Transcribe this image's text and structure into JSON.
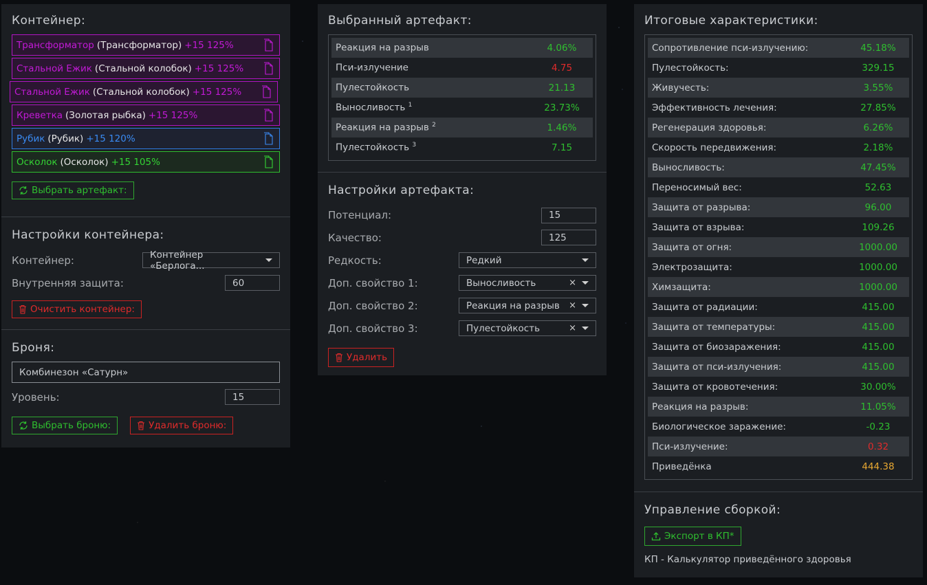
{
  "container_panel": {
    "title": "Контейнер:",
    "artifacts": [
      {
        "name": "Трансформатор",
        "copy": "(Трансформатор)",
        "bonus": "+15 125%",
        "color": "magenta"
      },
      {
        "name": "Стальной Ежик",
        "copy": "(Стальной колобок)",
        "bonus": "+15 125%",
        "color": "magenta"
      },
      {
        "name": "Стальной Ежик",
        "copy": "(Стальной колобок)",
        "bonus": "+15 125%",
        "color": "magenta"
      },
      {
        "name": "Креветка",
        "copy": "(Золотая рыбка)",
        "bonus": "+15 125%",
        "color": "magenta"
      },
      {
        "name": "Рубик",
        "copy": "(Рубик)",
        "bonus": "+15 120%",
        "color": "blue"
      },
      {
        "name": "Осколок",
        "copy": "(Осколок)",
        "bonus": "+15 105%",
        "color": "green"
      }
    ],
    "choose_artifact_btn": "Выбрать артефакт:"
  },
  "container_settings": {
    "title": "Настройки контейнера:",
    "container_label": "Контейнер:",
    "container_value": "Контейнер «Берлога...",
    "inner_protection_label": "Внутренняя защита:",
    "inner_protection_value": "60",
    "clear_btn": "Очистить контейнер:"
  },
  "armor": {
    "title": "Броня:",
    "name_value": "Комбинезон «Сатурн»",
    "level_label": "Уровень:",
    "level_value": "15",
    "choose_btn": "Выбрать броню:",
    "delete_btn": "Удалить броню:"
  },
  "selected_artifact": {
    "title": "Выбранный артефакт:",
    "stats": [
      {
        "label": "Реакция на разрыв",
        "sup": "",
        "value": "4.06%",
        "color": "g"
      },
      {
        "label": "Пси-излучение",
        "sup": "",
        "value": "4.75",
        "color": "r"
      },
      {
        "label": "Пулестойкость",
        "sup": "",
        "value": "21.13",
        "color": "g"
      },
      {
        "label": "Выносливость",
        "sup": "1",
        "value": "23.73%",
        "color": "g"
      },
      {
        "label": "Реакция на разрыв",
        "sup": "2",
        "value": "1.46%",
        "color": "g"
      },
      {
        "label": "Пулестойкость",
        "sup": "3",
        "value": "7.15",
        "color": "g"
      }
    ]
  },
  "artifact_settings": {
    "title": "Настройки артефакта:",
    "potential_label": "Потенциал:",
    "potential_value": "15",
    "quality_label": "Качество:",
    "quality_value": "125",
    "rarity_label": "Редкость:",
    "rarity_value": "Редкий",
    "prop1_label": "Доп. свойство 1:",
    "prop1_value": "Выносливость",
    "prop2_label": "Доп. свойство 2:",
    "prop2_value": "Реакция на разрыв",
    "prop3_label": "Доп. свойство 3:",
    "prop3_value": "Пулестойкость",
    "clear_x": "×",
    "delete_btn": "Удалить"
  },
  "totals": {
    "title": "Итоговые характеристики:",
    "stats": [
      {
        "label": "Сопротивление пси-излучению:",
        "value": "45.18%",
        "color": "g"
      },
      {
        "label": "Пулестойкость:",
        "value": "329.15",
        "color": "g"
      },
      {
        "label": "Живучесть:",
        "value": "3.55%",
        "color": "g"
      },
      {
        "label": "Эффективность лечения:",
        "value": "27.85%",
        "color": "g"
      },
      {
        "label": "Регенерация здоровья:",
        "value": "6.26%",
        "color": "g"
      },
      {
        "label": "Скорость передвижения:",
        "value": "2.18%",
        "color": "g"
      },
      {
        "label": "Выносливость:",
        "value": "47.45%",
        "color": "g"
      },
      {
        "label": "Переносимый вес:",
        "value": "52.63",
        "color": "g"
      },
      {
        "label": "Защита от разрыва:",
        "value": "96.00",
        "color": "g"
      },
      {
        "label": "Защита от взрыва:",
        "value": "109.26",
        "color": "g"
      },
      {
        "label": "Защита от огня:",
        "value": "1000.00",
        "color": "g"
      },
      {
        "label": "Электрозащита:",
        "value": "1000.00",
        "color": "g"
      },
      {
        "label": "Химзащита:",
        "value": "1000.00",
        "color": "g"
      },
      {
        "label": "Защита от радиации:",
        "value": "415.00",
        "color": "g"
      },
      {
        "label": "Защита от температуры:",
        "value": "415.00",
        "color": "g"
      },
      {
        "label": "Защита от биозаражения:",
        "value": "415.00",
        "color": "g"
      },
      {
        "label": "Защита от пси-излучения:",
        "value": "415.00",
        "color": "g"
      },
      {
        "label": "Защита от кровотечения:",
        "value": "30.00%",
        "color": "g"
      },
      {
        "label": "Реакция на разрыв:",
        "value": "11.05%",
        "color": "g"
      },
      {
        "label": "Биологическое заражение:",
        "value": "-0.23",
        "color": "g"
      },
      {
        "label": "Пси-излучение:",
        "value": "0.32",
        "color": "r"
      },
      {
        "label": "Приведёнка",
        "value": "444.38",
        "color": "o"
      }
    ]
  },
  "build": {
    "title": "Управление сборкой:",
    "export_btn": "Экспорт в КП*",
    "note": "КП - Калькулятор приведённого здоровья"
  }
}
